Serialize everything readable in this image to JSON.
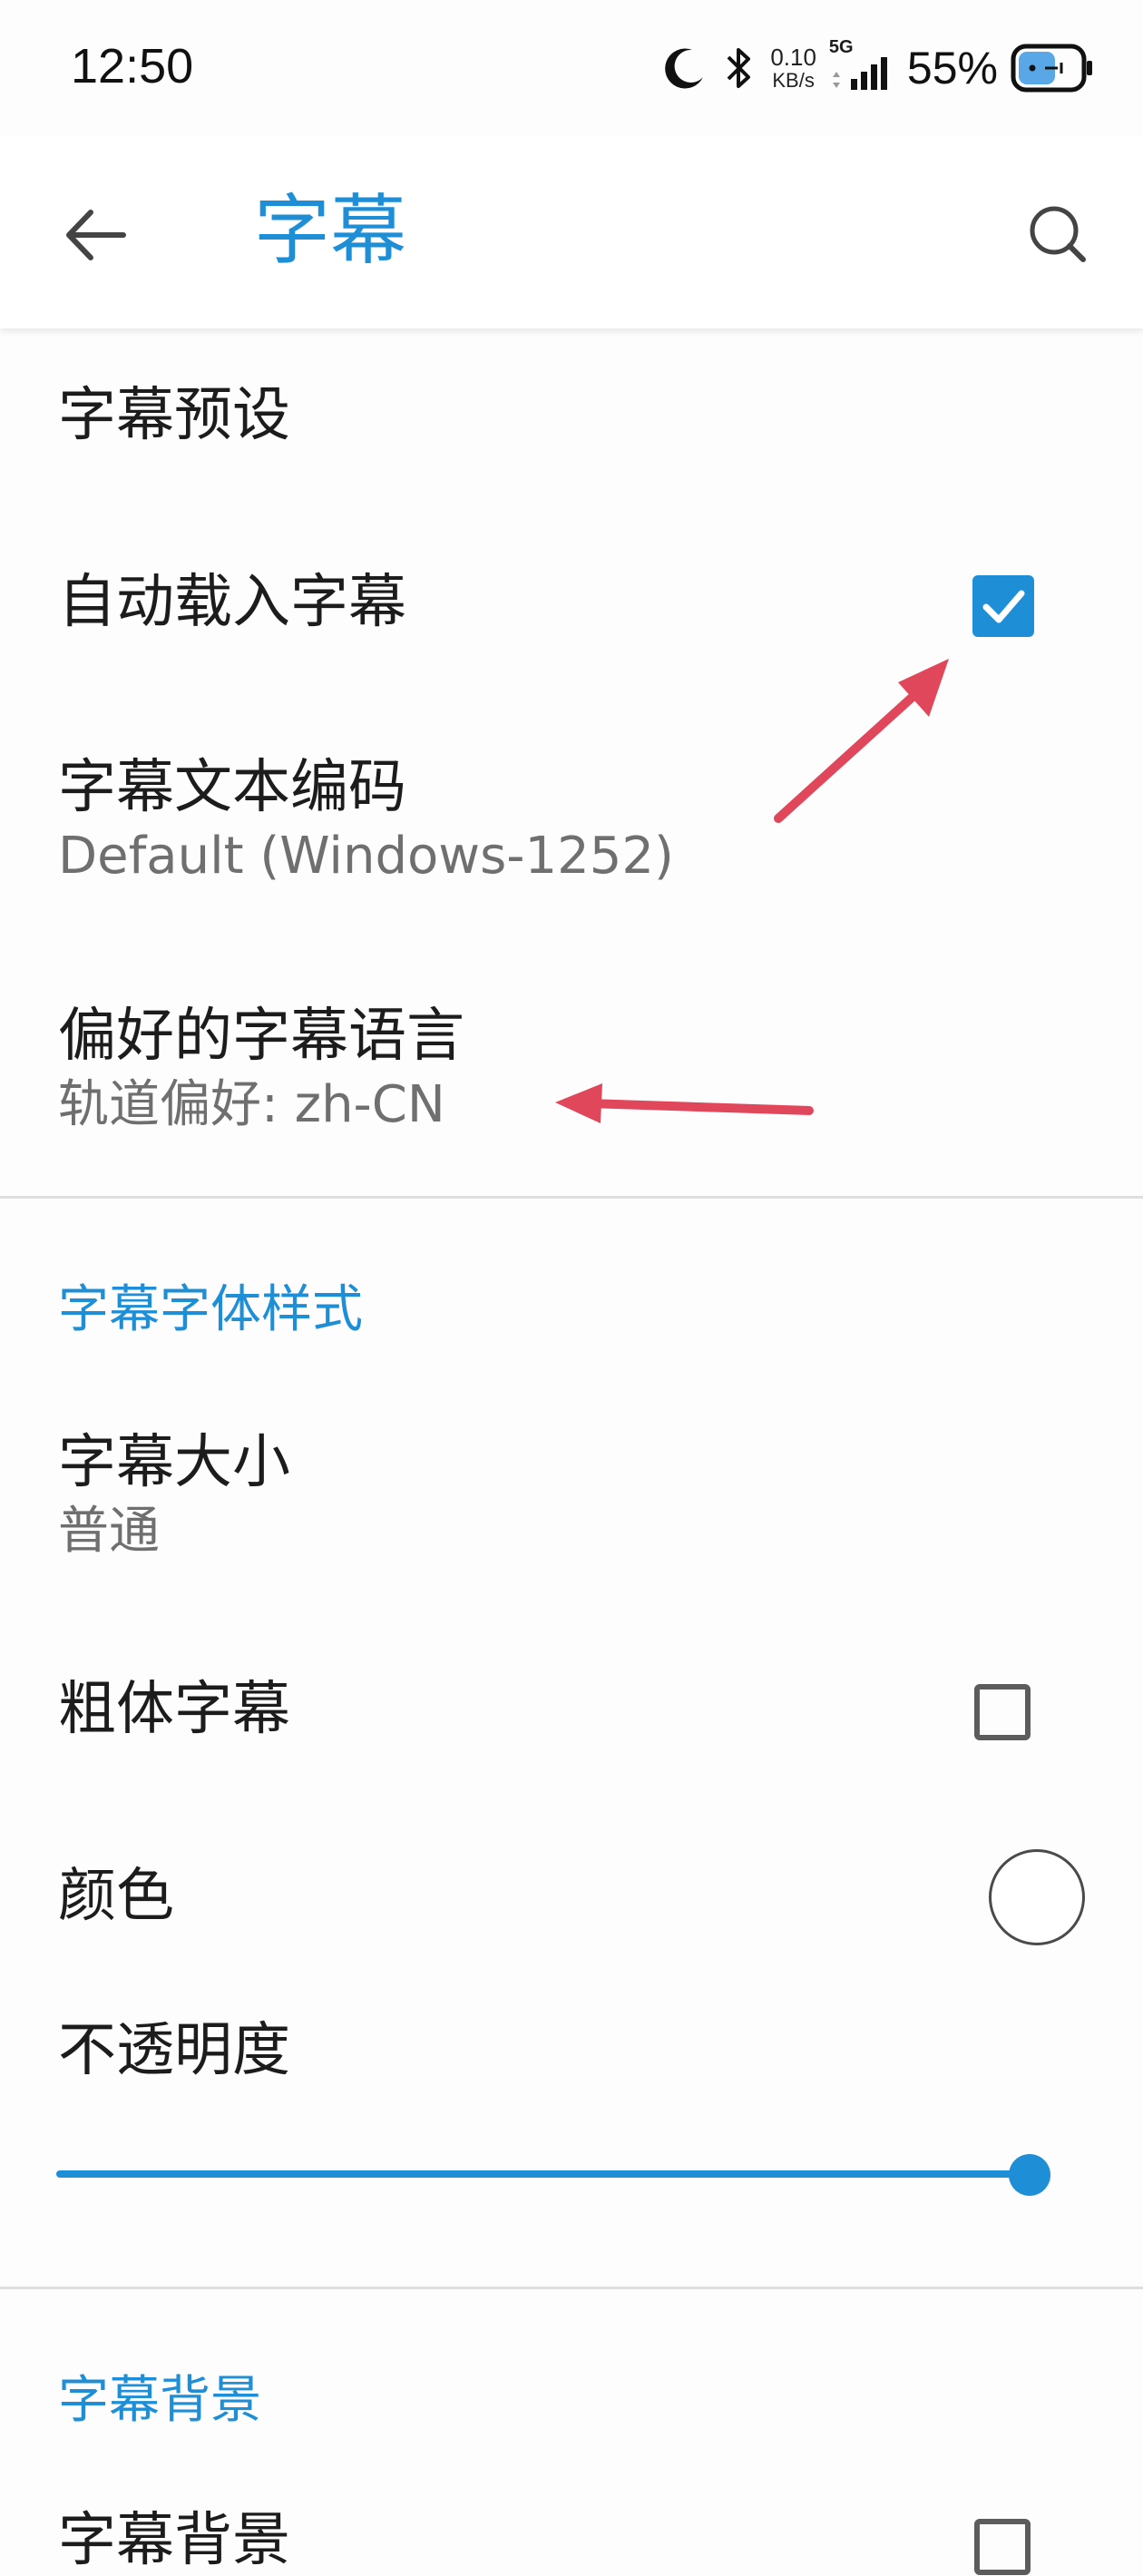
{
  "status_bar": {
    "time": "12:50",
    "net_speed_value": "0.10",
    "net_speed_unit": "KB/s",
    "network_type": "5G",
    "battery_percent": "55%",
    "icons": [
      "moon-icon",
      "bluetooth-icon",
      "signal-icon",
      "battery-icon"
    ]
  },
  "app_bar": {
    "title": "字幕",
    "back_icon": "arrow-left-icon",
    "search_icon": "search-icon"
  },
  "settings": {
    "subtitle_preset": {
      "title": "字幕预设"
    },
    "auto_load": {
      "title": "自动载入字幕",
      "checked": true
    },
    "text_encoding": {
      "title": "字幕文本编码",
      "summary": "Default (Windows-1252)"
    },
    "preferred_language": {
      "title": "偏好的字幕语言",
      "summary": "轨道偏好: zh-CN"
    }
  },
  "font_style_section": {
    "header": "字幕字体样式",
    "size": {
      "title": "字幕大小",
      "summary": "普通"
    },
    "bold": {
      "title": "粗体字幕",
      "checked": false
    },
    "color": {
      "title": "颜色",
      "value": "#ffffff"
    },
    "opacity": {
      "title": "不透明度",
      "value": 1.0
    }
  },
  "background_section": {
    "header": "字幕背景",
    "background": {
      "title": "字幕背景",
      "checked": false
    }
  },
  "colors": {
    "accent": "#1e8fd6",
    "annotation_arrow": "#e0475a"
  }
}
